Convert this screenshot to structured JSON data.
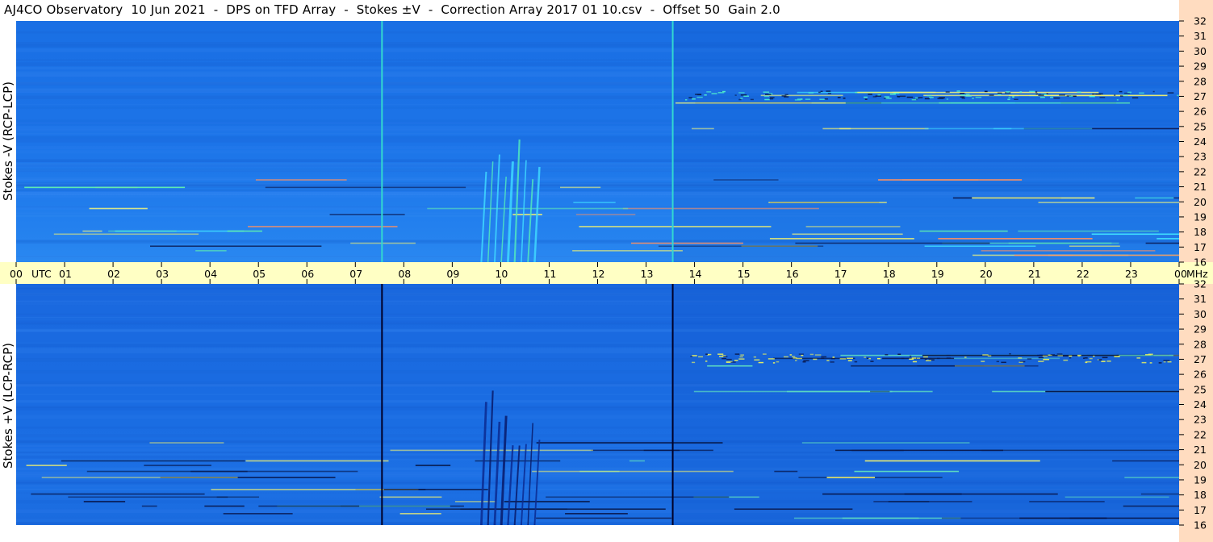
{
  "title": "AJ4CO Observatory  10 Jun 2021  -  DPS on TFD Array  -  Stokes ±V  -  Correction Array 2017 01 10.csv  -  Offset 50  Gain 2.0",
  "colors": {
    "background_blue": "#1e74e6",
    "time_strip": "#ffffc4",
    "freq_strip": "#ffdcc0",
    "marker_top": "#33d8d0",
    "marker_bottom": "#000028"
  },
  "chart_data": {
    "type": "heatmap",
    "title": "AJ4CO Observatory  10 Jun 2021  -  DPS on TFD Array  -  Stokes ±V  -  Correction Array 2017 01 10.csv  -  Offset 50  Gain 2.0",
    "x_unit": "UTC",
    "y_unit": "MHz",
    "xlim": [
      0,
      24
    ],
    "ylim": [
      16,
      32
    ],
    "x_ticks": [
      "00",
      "01",
      "02",
      "03",
      "04",
      "05",
      "06",
      "07",
      "08",
      "09",
      "10",
      "11",
      "12",
      "13",
      "14",
      "15",
      "16",
      "17",
      "18",
      "19",
      "20",
      "21",
      "22",
      "23",
      "00"
    ],
    "y_ticks": [
      "16",
      "17",
      "18",
      "19",
      "20",
      "21",
      "22",
      "23",
      "24",
      "25",
      "26",
      "27",
      "28",
      "29",
      "30",
      "31",
      "32"
    ],
    "panels": [
      {
        "ylabel": "Stokes -V (RCP-LCP)",
        "marker_hours": [
          7.55,
          13.55
        ]
      },
      {
        "ylabel": "Stokes +V (LCP-RCP)",
        "marker_hours": [
          7.55,
          13.55
        ]
      }
    ],
    "burst": {
      "start_hour": 9.6,
      "end_hour": 10.7,
      "top_mhz": 25.2
    }
  }
}
